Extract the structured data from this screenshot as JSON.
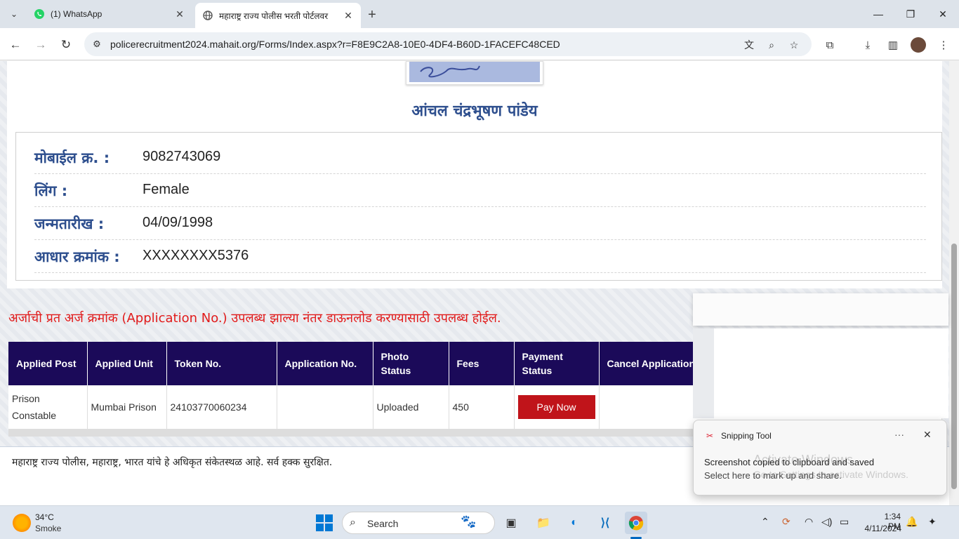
{
  "browser": {
    "tabs": [
      {
        "title": "(1) WhatsApp",
        "icon": "whatsapp-icon"
      },
      {
        "title": "महाराष्ट्र राज्य पोलीस भरती पोर्टलवर",
        "icon": "globe-icon"
      }
    ],
    "url": "policerecruitment2024.mahait.org/Forms/Index.aspx?r=F8E9C2A8-10E0-4DF4-B60D-1FACEFC48CED"
  },
  "page": {
    "candidate_name": "आंचल चंद्रभूषण पांडेय",
    "info": [
      {
        "label": "मोबाईल क्र. :",
        "value": "9082743069"
      },
      {
        "label": "लिंग :",
        "value": "Female"
      },
      {
        "label": "जन्मतारीख :",
        "value": "04/09/1998"
      },
      {
        "label": "आधार क्रमांक :",
        "value": "XXXXXXXX5376"
      }
    ],
    "notice": "अर्जाची प्रत अर्ज क्रमांक (Application No.) उपलब्ध झाल्या नंतर डाऊनलोड करण्यासाठी उपलब्ध होईल.",
    "table": {
      "headers": [
        "Applied Post",
        "Applied Unit",
        "Token No.",
        "Application No.",
        "Photo Status",
        "Fees",
        "Payment Status",
        "Cancel Application"
      ],
      "rows": [
        {
          "post": "Prison Constable",
          "unit": "Mumbai Prison",
          "token": "24103770060234",
          "app_no": "",
          "photo": "Uploaded",
          "fees": "450",
          "pay_label": "Pay Now",
          "cancel": ""
        }
      ]
    },
    "footer": "महाराष्ट्र राज्य पोलीस, महाराष्ट्र, भारत यांचे हे अधिकृत संकेतस्थळ आहे. सर्व हक्क सुरक्षित."
  },
  "notification": {
    "app": "Snipping Tool",
    "title": "Screenshot copied to clipboard and saved",
    "subtitle": "Select here to mark up and share.",
    "watermark": "Activate Windows",
    "watermark_sub": "Go to Settings to activate Windows."
  },
  "taskbar": {
    "weather_temp": "34°C",
    "weather_cond": "Smoke",
    "search_placeholder": "Search",
    "time": "1:34 PM",
    "date": "4/11/2024"
  },
  "colors": {
    "table_header": "#1b0a59",
    "pay_button": "#c0141a",
    "label_blue": "#2e4f8e",
    "notice_red": "#e11b1b"
  }
}
